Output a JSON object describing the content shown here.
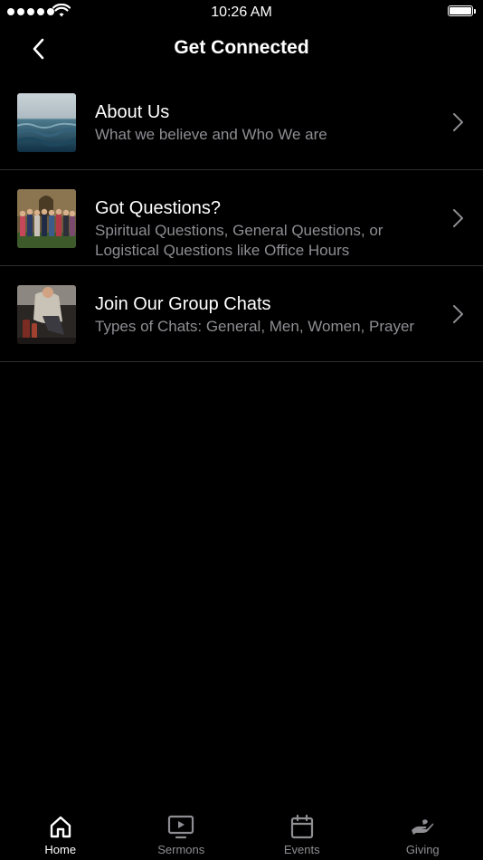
{
  "status_bar": {
    "time": "10:26 AM"
  },
  "nav": {
    "title": "Get Connected",
    "back_icon": "chevron-left-icon"
  },
  "rows": [
    {
      "title": "About Us",
      "subtitle": "What we believe and Who We are",
      "thumbnail": "ocean-waves-image"
    },
    {
      "title": "Got Questions?",
      "subtitle": "Spiritual Questions, General Questions, or Logistical Questions like Office Hours",
      "thumbnail": "group-photo-image"
    },
    {
      "title": "Join Our Group Chats",
      "subtitle": "Types of Chats: General, Men, Women, Prayer",
      "thumbnail": "group-chat-image"
    }
  ],
  "tabs": [
    {
      "label": "Home",
      "icon": "home-icon",
      "active": true
    },
    {
      "label": "Sermons",
      "icon": "play-screen-icon",
      "active": false
    },
    {
      "label": "Events",
      "icon": "calendar-icon",
      "active": false
    },
    {
      "label": "Giving",
      "icon": "giving-hand-icon",
      "active": false
    }
  ],
  "colors": {
    "background": "#000000",
    "text_primary": "#ffffff",
    "text_secondary": "#8e8e93",
    "separator": "#2e2e2e"
  }
}
